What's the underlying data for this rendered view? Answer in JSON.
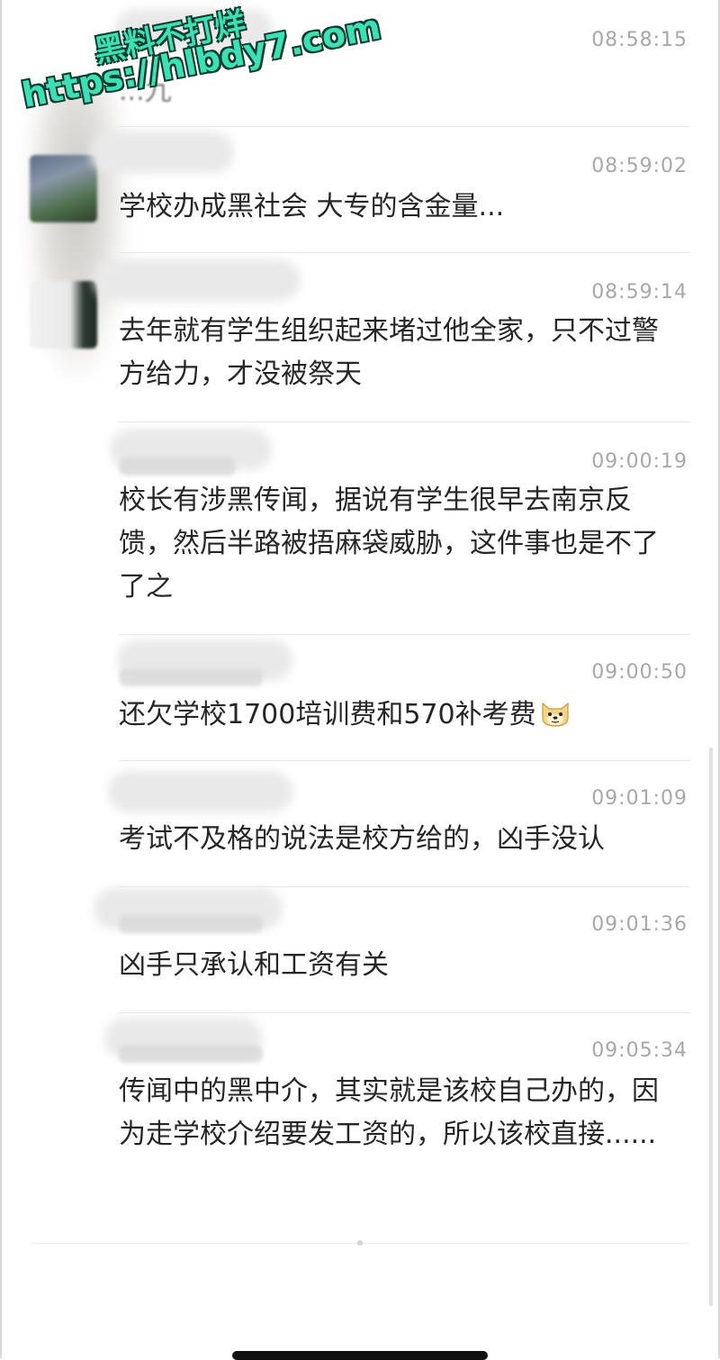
{
  "watermark": {
    "line1": "黑料不打烊",
    "line2": "https://hlbdy7.com"
  },
  "messages": [
    {
      "time": "08:58:15",
      "text": "...九"
    },
    {
      "time": "08:59:02",
      "text": "学校办成黑社会 大专的含金量..."
    },
    {
      "time": "08:59:14",
      "text": "去年就有学生组织起来堵过他全家，只不过警方给力，才没被祭天"
    },
    {
      "time": "09:00:19",
      "text": "校长有涉黑传闻，据说有学生很早去南京反馈，然后半路被捂麻袋威胁，这件事也是不了了之"
    },
    {
      "time": "09:00:50",
      "text": "还欠学校1700培训费和570补考费",
      "emoji": "doge-face-icon"
    },
    {
      "time": "09:01:09",
      "text": "考试不及格的说法是校方给的，凶手没认"
    },
    {
      "time": "09:01:36",
      "text": "凶手只承认和工资有关"
    },
    {
      "time": "09:05:34",
      "text": "传闻中的黑中介，其实就是该校自己办的，因为走学校介绍要发工资的，所以该校直接......"
    }
  ],
  "colors": {
    "watermark_fill": "#3de0b5",
    "watermark_outline": "#0b3d2f",
    "time_text": "#a8a8a8",
    "message_text": "#262626"
  }
}
